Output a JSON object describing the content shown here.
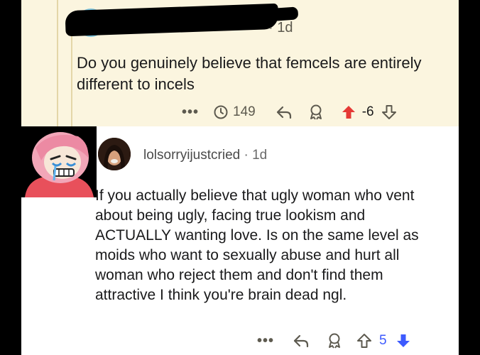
{
  "top_comment": {
    "time": "· 1d",
    "body": "Do you genuinely believe that femcels are entirely different to incels",
    "views": "149",
    "score": "-6",
    "more_label": "•••"
  },
  "bottom_comment": {
    "username": "lolsorryijustcried",
    "time": "· 1d",
    "body": "If you actually believe that ugly woman who vent about being ugly, facing true lookism and ACTUALLY wanting love. Is on the same level as moids who want to sexually abuse and hurt all woman who reject them and don't find them attractive I think you're brain dead ngl.",
    "score": "5",
    "more_label": "•••"
  },
  "colors": {
    "top_bg": "#fbf5df",
    "bottom_bg": "#ffffff",
    "downvote_active": "#e53935",
    "upvote_active": "#3d5afe"
  },
  "icons": [
    "views-icon",
    "reply-icon",
    "award-icon",
    "upvote-icon",
    "downvote-icon"
  ]
}
